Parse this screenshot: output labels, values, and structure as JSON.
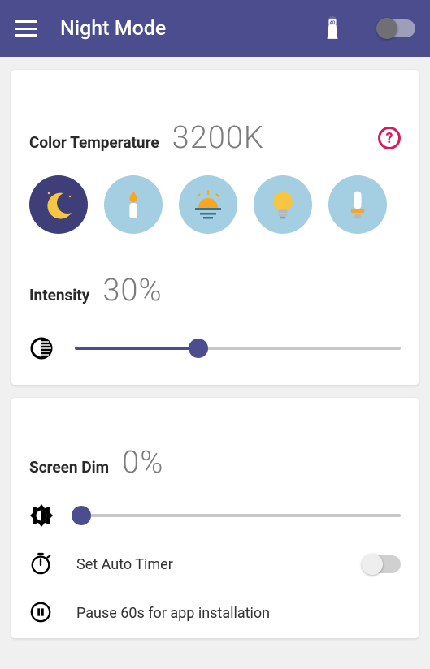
{
  "header": {
    "title": "Night Mode",
    "master_toggle": false
  },
  "color_temp": {
    "label": "Color Temperature",
    "value": "3200K",
    "presets": [
      {
        "name": "moon",
        "active": true
      },
      {
        "name": "candle",
        "active": false
      },
      {
        "name": "sunset",
        "active": false
      },
      {
        "name": "bulb",
        "active": false
      },
      {
        "name": "fluorescent",
        "active": false
      }
    ]
  },
  "intensity": {
    "label": "Intensity",
    "value": "30%",
    "slider_pct": 38
  },
  "screen_dim": {
    "label": "Screen Dim",
    "value": "0%",
    "slider_pct": 2
  },
  "options": {
    "auto_timer": {
      "label": "Set Auto Timer",
      "toggle": false
    },
    "pause": {
      "label": "Pause 60s for app installation"
    }
  },
  "help_glyph": "?"
}
